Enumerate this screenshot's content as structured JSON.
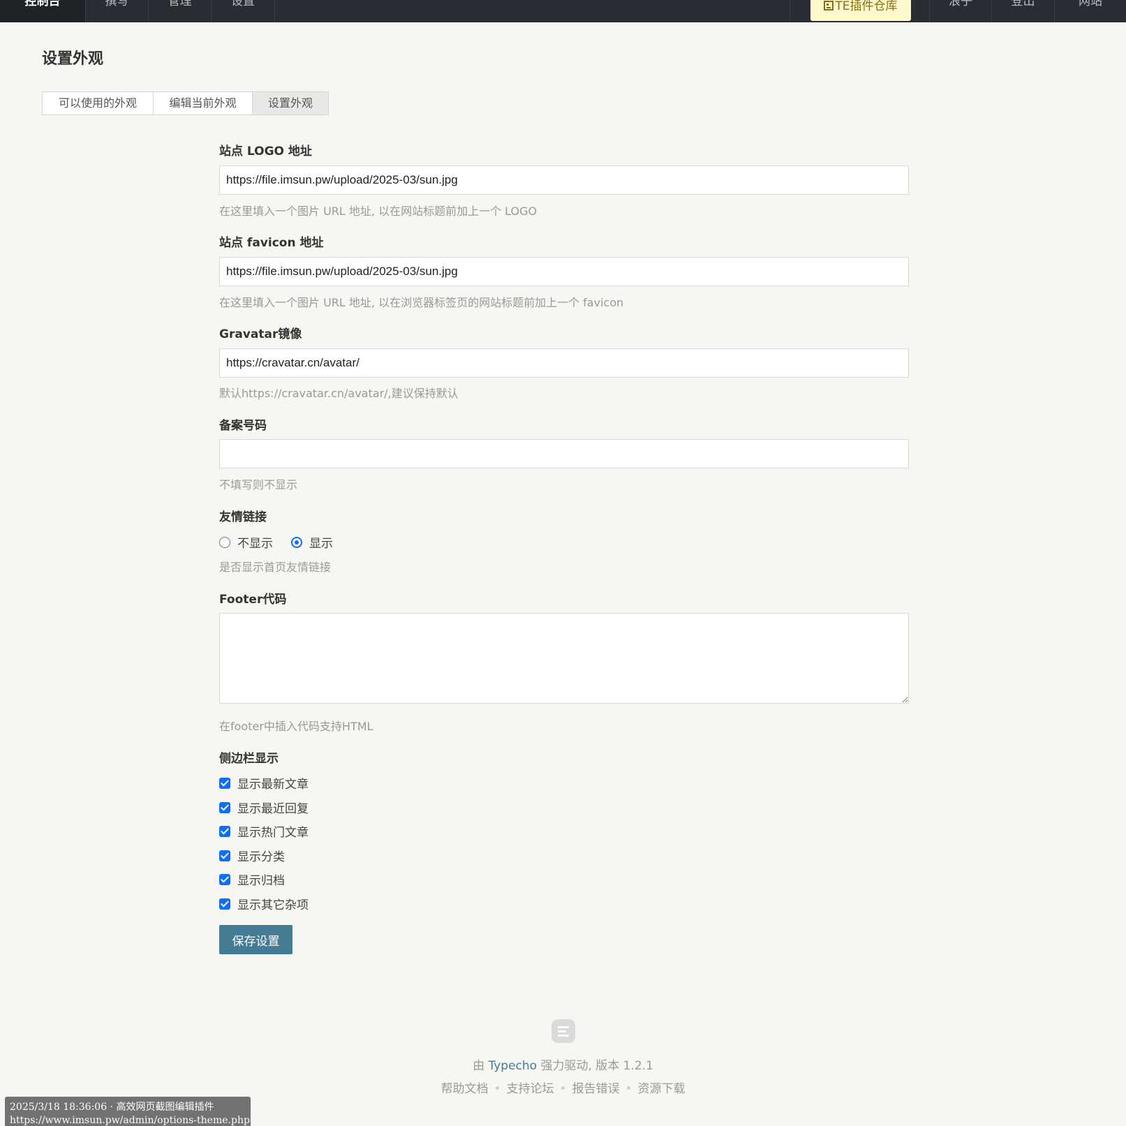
{
  "nav": {
    "left": [
      "控制台",
      "撰写",
      "管理",
      "设置"
    ],
    "plugin": "TE插件仓库",
    "right": [
      "浪子",
      "登出",
      "网站"
    ]
  },
  "page": {
    "title": "设置外观",
    "tabs": [
      "可以使用的外观",
      "编辑当前外观",
      "设置外观"
    ],
    "active_tab": "设置外观"
  },
  "form": {
    "logo": {
      "label": "站点 LOGO 地址",
      "value": "https://file.imsun.pw/upload/2025-03/sun.jpg",
      "hint": "在这里填入一个图片 URL 地址, 以在网站标题前加上一个 LOGO"
    },
    "favicon": {
      "label": "站点 favicon 地址",
      "value": "https://file.imsun.pw/upload/2025-03/sun.jpg",
      "hint": "在这里填入一个图片 URL 地址, 以在浏览器标签页的网站标题前加上一个 favicon"
    },
    "gravatar": {
      "label": "Gravatar镜像",
      "value": "https://cravatar.cn/avatar/",
      "hint": "默认https://cravatar.cn/avatar/,建议保持默认"
    },
    "icp": {
      "label": "备案号码",
      "value": "",
      "hint": "不填写则不显示"
    },
    "friendlinks": {
      "label": "友情链接",
      "options": [
        "不显示",
        "显示"
      ],
      "selected": "显示",
      "hint": "是否显示首页友情链接"
    },
    "footer": {
      "label": "Footer代码",
      "value": "",
      "hint": "在footer中插入代码支持HTML"
    },
    "sidebar": {
      "label": "侧边栏显示",
      "options": [
        "显示最新文章",
        "显示最近回复",
        "显示热门文章",
        "显示分类",
        "显示归档",
        "显示其它杂项"
      ]
    },
    "submit": "保存设置"
  },
  "footer": {
    "powered_prefix": "由",
    "powered_name": "Typecho",
    "powered_suffix": "强力驱动, 版本 1.2.1",
    "links": [
      "帮助文档",
      "支持论坛",
      "报告错误",
      "资源下载"
    ]
  },
  "status_overlay": {
    "line1": "2025/3/18 18:36:06 · 高效网页截图编辑插件",
    "line2": "https://www.imsun.pw/admin/options-theme.php"
  },
  "colors": {
    "nav_bg": "#292d33",
    "accent": "#467b96",
    "checkbox": "#0d6efd",
    "plugin_bg": "#fff9cb"
  }
}
